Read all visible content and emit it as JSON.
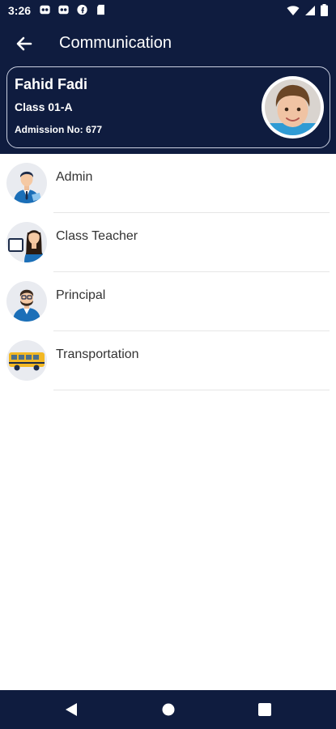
{
  "status_bar": {
    "time": "3:26",
    "left_icons": [
      "app-notification-icon",
      "app-notification-icon",
      "facebook-notification-icon",
      "sd-card-icon"
    ],
    "right_icons": [
      "wifi-icon",
      "signal-icon",
      "battery-icon"
    ]
  },
  "header": {
    "title": "Communication",
    "back_icon": "back-arrow-icon"
  },
  "student": {
    "name": "Fahid Fadi",
    "class": "Class 01-A",
    "admission": "Admission No: 677"
  },
  "contacts": [
    {
      "label": "Admin",
      "icon": "admin-avatar-icon"
    },
    {
      "label": "Class Teacher",
      "icon": "class-teacher-avatar-icon"
    },
    {
      "label": "Principal",
      "icon": "principal-avatar-icon"
    },
    {
      "label": "Transportation",
      "icon": "school-bus-icon"
    }
  ],
  "navbar": {
    "icons": [
      "back-triangle-icon",
      "home-circle-icon",
      "recents-square-icon"
    ]
  },
  "colors": {
    "primary": "#0f1c3f",
    "card_border": "#c9cfe0",
    "icon_bg": "#e9ebf0",
    "text": "#333333"
  }
}
